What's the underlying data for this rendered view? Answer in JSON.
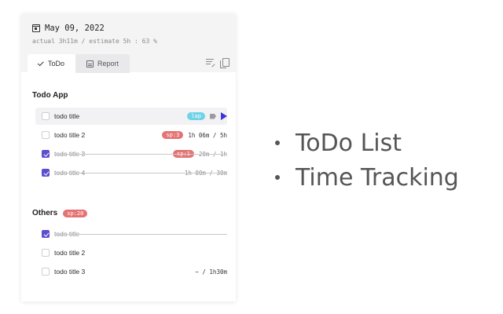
{
  "header": {
    "date": "May 09, 2022",
    "stats": "actual 3h11m / estimate 5h : 63 %"
  },
  "tabs": [
    {
      "label": "ToDo",
      "icon": "check-icon",
      "active": true
    },
    {
      "label": "Report",
      "icon": "report-icon",
      "active": false
    }
  ],
  "groups": [
    {
      "title": "Todo App",
      "badge": "",
      "items": [
        {
          "title": "todo title",
          "checked": false,
          "badge": "lap",
          "badge_color": "#6ed3e6",
          "time": ""
        },
        {
          "title": "todo title 2",
          "checked": false,
          "badge": "sp:3",
          "badge_color": "#e57373",
          "time": "1h 06m / 5h"
        },
        {
          "title": "todo title 3",
          "checked": true,
          "badge": "sp:1",
          "badge_color": "#e57373",
          "time": "20m / 1h"
        },
        {
          "title": "todo title 4",
          "checked": true,
          "badge": "",
          "time": "1h 00m / 30m"
        }
      ]
    },
    {
      "title": "Others",
      "badge": "sp:20",
      "items": [
        {
          "title": "todo title",
          "checked": true,
          "badge": "",
          "time": ""
        },
        {
          "title": "todo title 2",
          "checked": false,
          "badge": "",
          "time": ""
        },
        {
          "title": "todo title 3",
          "checked": false,
          "badge": "",
          "time": "~ / 1h30m"
        }
      ]
    }
  ],
  "features": [
    "ToDo List",
    "Time Tracking"
  ],
  "colors": {
    "accent": "#5b4fcf",
    "play": "#3b36d6",
    "badge_red": "#e57373",
    "badge_cyan": "#6ed3e6"
  }
}
